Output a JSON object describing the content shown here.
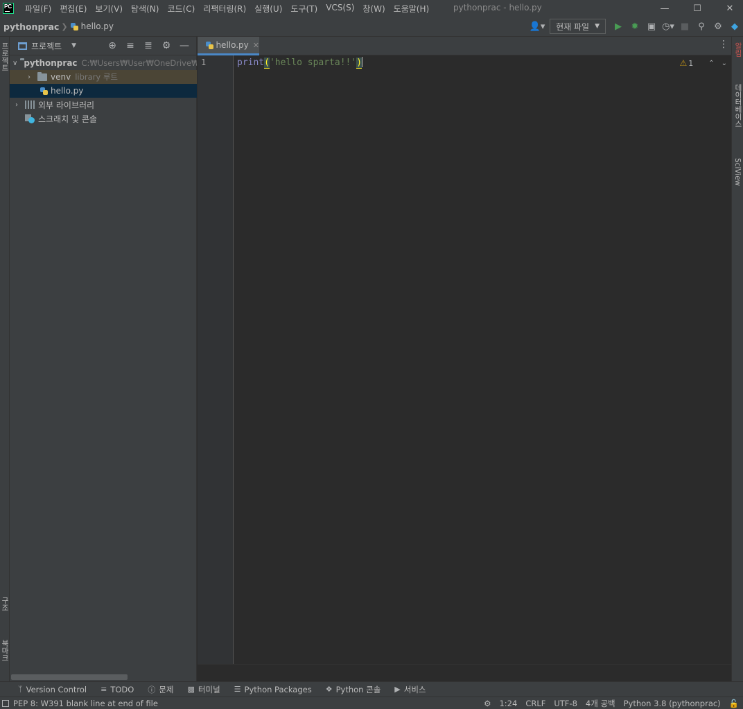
{
  "app": {
    "logo_text": "PC",
    "window_title": "pythonprac - hello.py"
  },
  "menu": [
    "파일(F)",
    "편집(E)",
    "보기(V)",
    "탐색(N)",
    "코드(C)",
    "리팩터링(R)",
    "실행(U)",
    "도구(T)",
    "VCS(S)",
    "창(W)",
    "도움말(H)"
  ],
  "navbar": {
    "project": "pythonprac",
    "file": "hello.py",
    "run_config": "현재 파일"
  },
  "left_strip": {
    "project_label": "프로젝트",
    "structure_label": "구조",
    "bookmarks_label": "북마크"
  },
  "right_strip": {
    "notifications_label": "알림",
    "database_label": "데이터베이스",
    "sciview_label": "SciView"
  },
  "project_panel": {
    "title": "프로젝트",
    "root_name": "pythonprac",
    "root_path": "C:₩Users₩User₩OneDrive₩바",
    "venv_name": "venv",
    "venv_hint": "library 루트",
    "file_name": "hello.py",
    "external_libs": "외부 라이브러리",
    "scratches": "스크래치 및 콘솔"
  },
  "editor": {
    "tab_name": "hello.py",
    "line_number": "1",
    "code_func": "print",
    "code_open": "(",
    "code_string": "'hello sparta!!'",
    "code_close": ")",
    "warning_count": "1"
  },
  "tool_windows": [
    "Version Control",
    "TODO",
    "문제",
    "터미널",
    "Python Packages",
    "Python 콘솔",
    "서비스"
  ],
  "status": {
    "message": "PEP 8: W391 blank line at end of file",
    "position": "1:24",
    "line_sep": "CRLF",
    "encoding": "UTF-8",
    "indent": "4개 공백",
    "interpreter": "Python 3.8 (pythonprac)"
  },
  "colors": {
    "accent": "#4a88c7",
    "selection": "#0d293e",
    "run_green": "#499c54",
    "warning": "#be9117"
  }
}
